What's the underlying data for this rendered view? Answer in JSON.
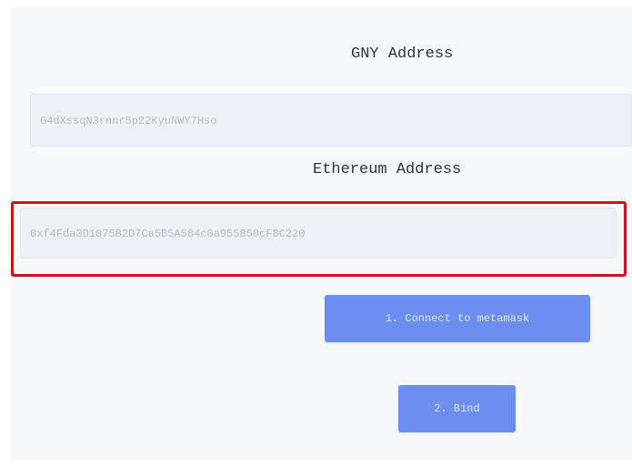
{
  "gny": {
    "label": "GNY Address",
    "value": "G4dXssqN3rnnr5p22KyuNWY7Hso"
  },
  "ethereum": {
    "label": "Ethereum Address",
    "value": "0xf4Fda3D1075B2D7Ca5B5A584c0a955B50cF8C220"
  },
  "buttons": {
    "connect_label": "1. Connect to metamask",
    "bind_label": "2. Bind"
  },
  "colors": {
    "highlight": "#c8141c",
    "button": "#6b8ef0",
    "field": "#eef0f6"
  }
}
